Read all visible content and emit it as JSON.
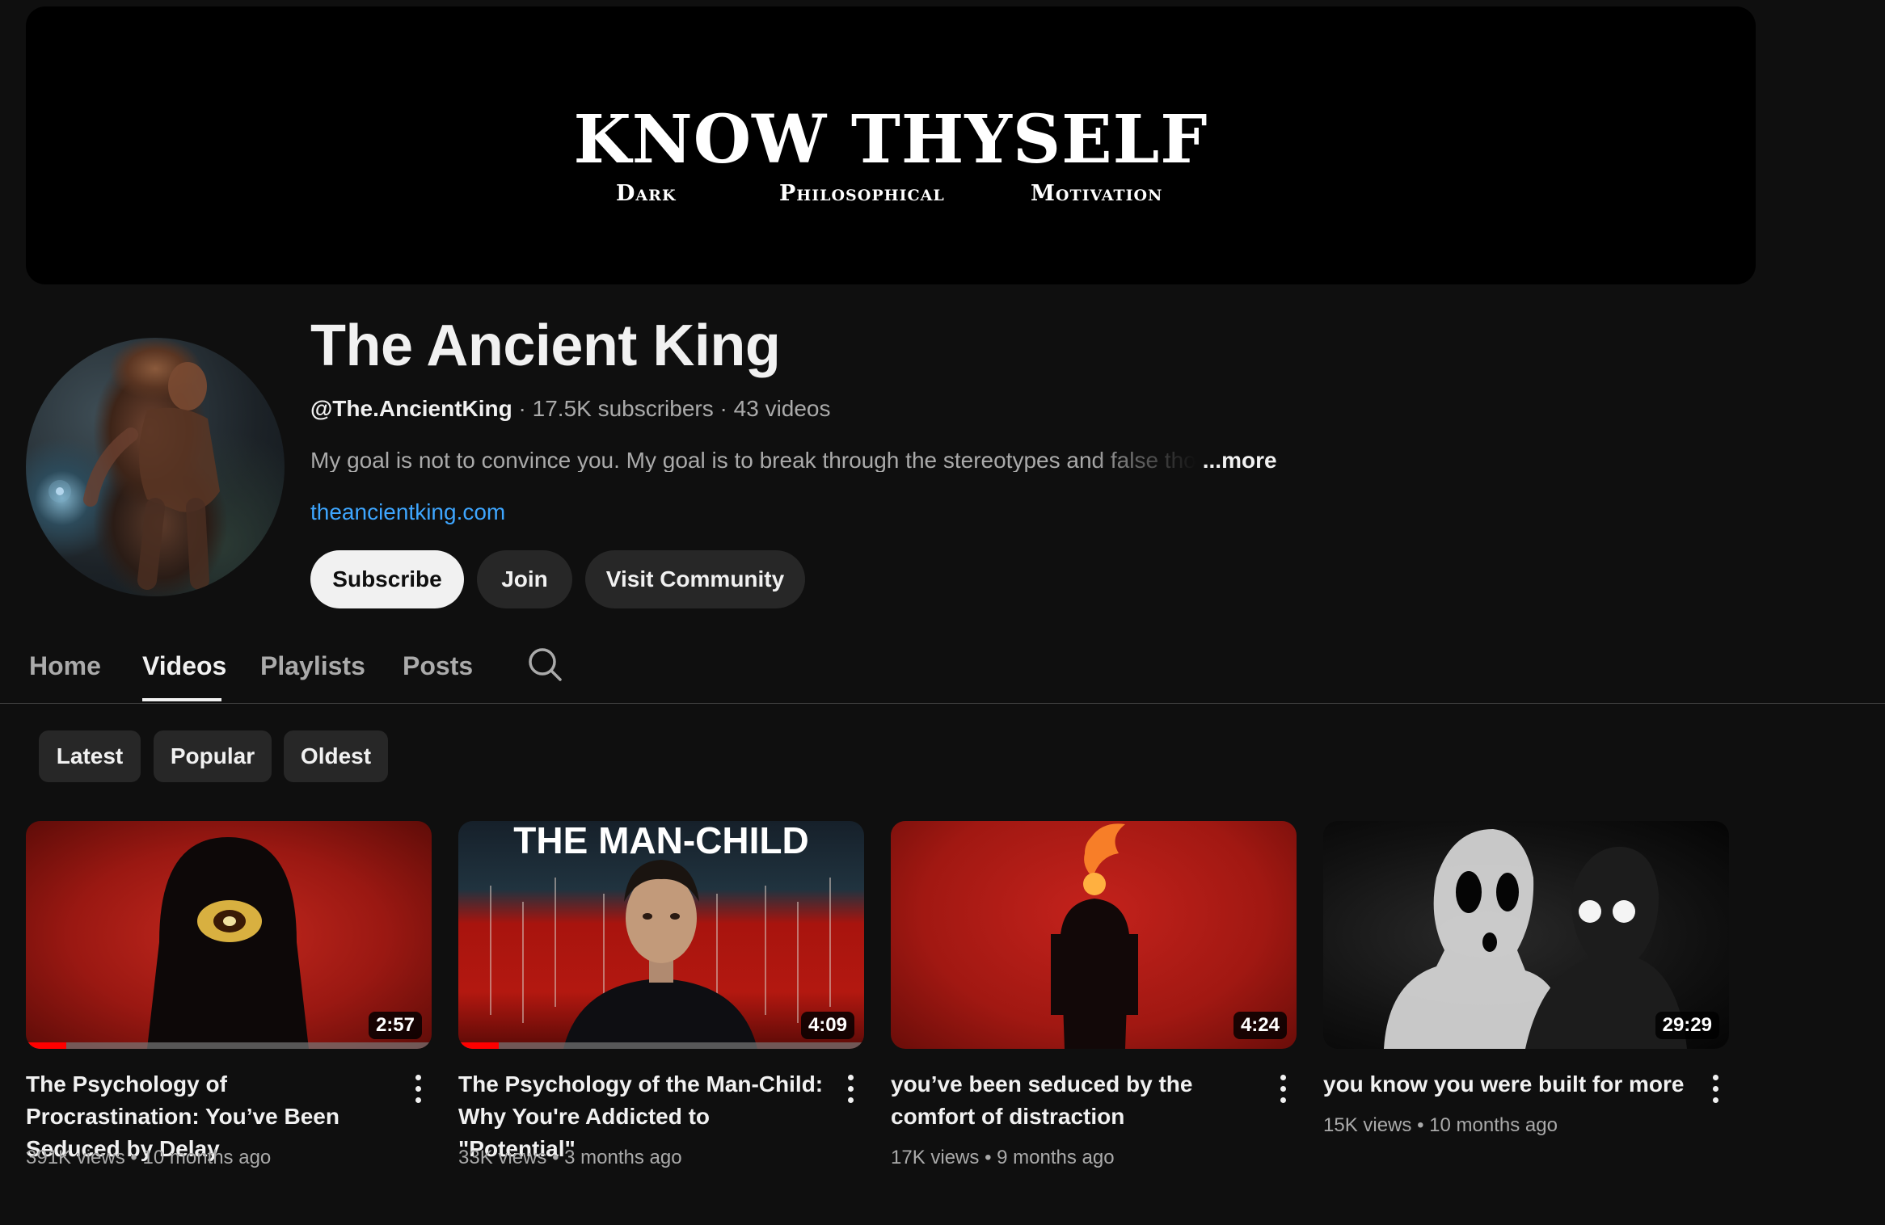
{
  "banner": {
    "title": "KNOW THYSELF",
    "subtitle_left": "Dark",
    "subtitle_center": "Philosophical",
    "subtitle_right": "Motivation"
  },
  "channel": {
    "name": "The Ancient King",
    "handle": "@The.AncientKing",
    "subscribers": "17.5K subscribers",
    "videos": "43 videos",
    "separator": "·",
    "description": "My goal is not to convince you. My goal is to break through the stereotypes and false tho",
    "more_label": "...more",
    "link": "theancientking.com"
  },
  "actions": {
    "subscribe": "Subscribe",
    "join": "Join",
    "visit_community": "Visit Community"
  },
  "tabs": [
    "Home",
    "Videos",
    "Playlists",
    "Posts"
  ],
  "active_tab": "Videos",
  "chips": [
    "Latest",
    "Popular",
    "Oldest"
  ],
  "videos": [
    {
      "title": "The Psychology of Procrastination: You’ve Been Seduced by Delay",
      "views": "391K views",
      "age": "10 months ago",
      "duration": "2:57",
      "watched_fraction": 0.1
    },
    {
      "title": "The Psychology of the Man-Child: Why You're Addicted to \"Potential\"",
      "thumb_text": "THE MAN-CHILD",
      "views": "33K views",
      "age": "3 months ago",
      "duration": "4:09",
      "watched_fraction": 0.1
    },
    {
      "title": "you’ve been seduced by the comfort of distraction",
      "views": "17K views",
      "age": "9 months ago",
      "duration": "4:24",
      "watched_fraction": 0
    },
    {
      "title": "you know you were built for more",
      "views": "15K views",
      "age": "10 months ago",
      "duration": "29:29",
      "watched_fraction": 0
    }
  ],
  "colors": {
    "background": "#0f0f0f",
    "link": "#3ea6ff",
    "progress": "#ff0000"
  }
}
